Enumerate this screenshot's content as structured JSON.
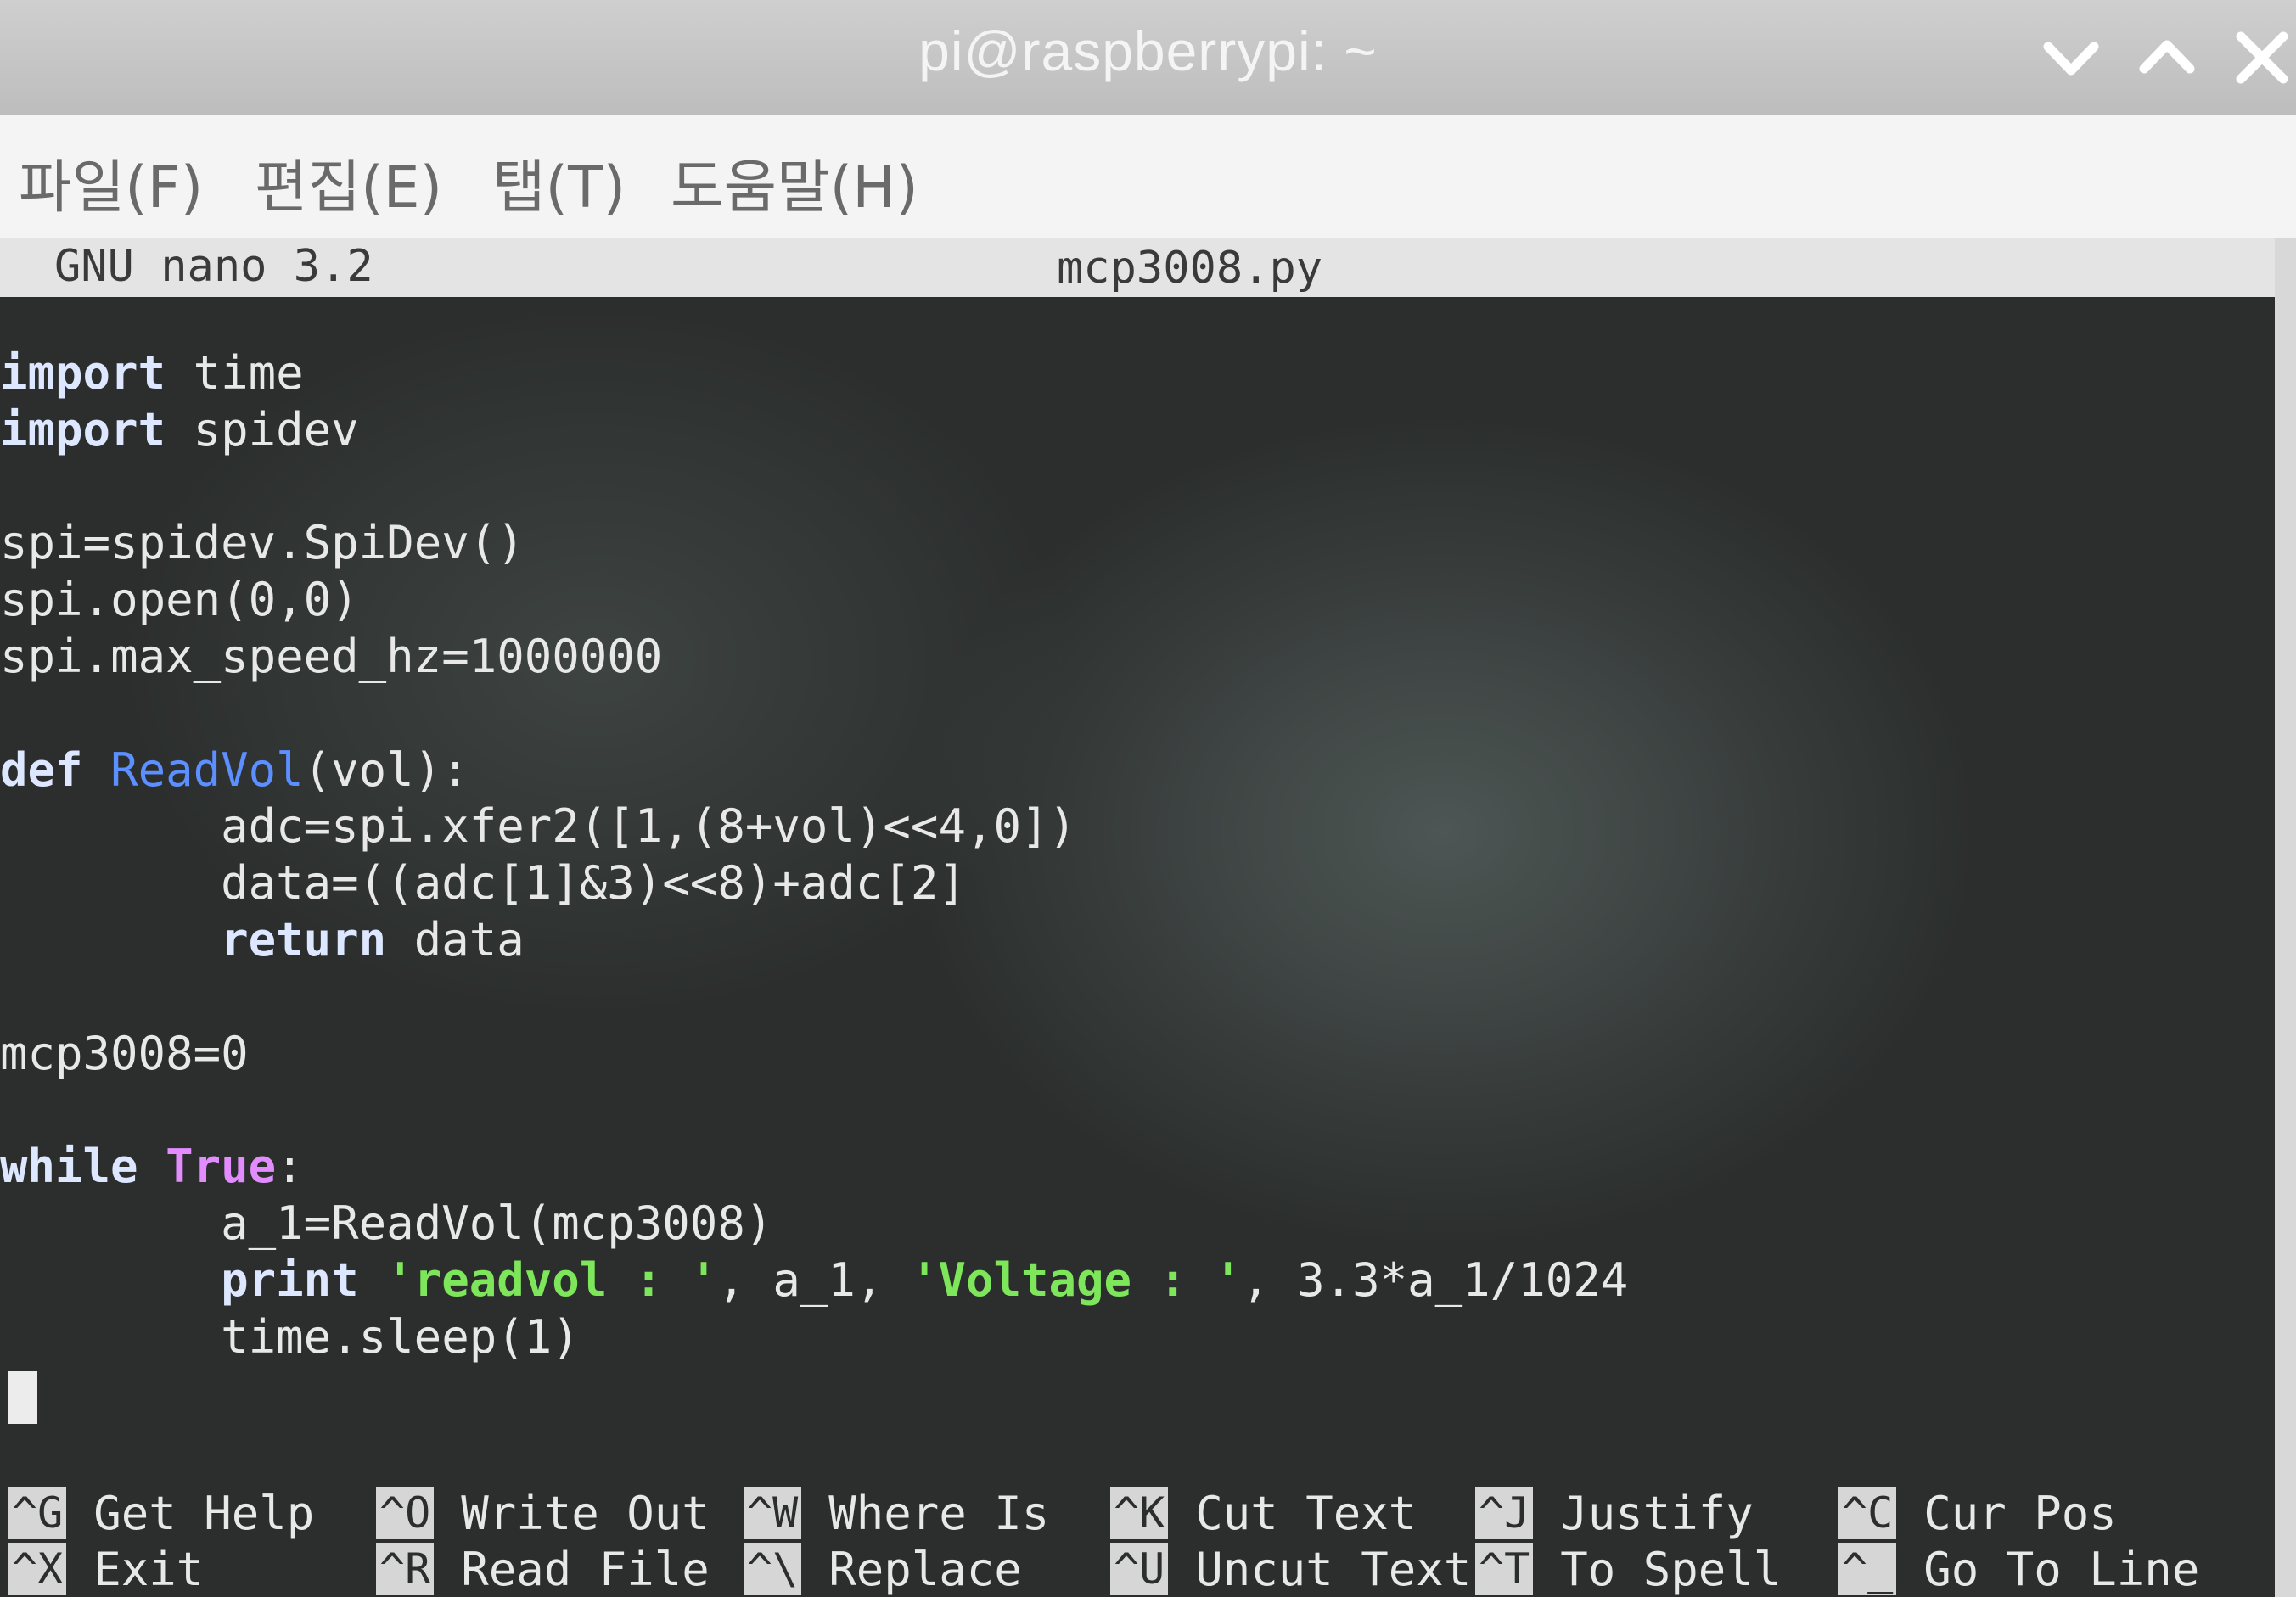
{
  "window": {
    "title": "pi@raspberrypi: ~"
  },
  "menu": {
    "items": [
      "파일(F)",
      "편집(E)",
      "탭(T)",
      "도움말(H)"
    ]
  },
  "nano": {
    "version": "GNU nano 3.2",
    "filename": "mcp3008.py"
  },
  "code_lines": [
    "import time",
    "import spidev",
    "",
    "spi=spidev.SpiDev()",
    "spi.open(0,0)",
    "spi.max_speed_hz=1000000",
    "",
    "def ReadVol(vol):",
    "        adc=spi.xfer2([1,(8+vol)<<4,0])",
    "        data=((adc[1]&3)<<8)+adc[2]",
    "        return data",
    "",
    "mcp3008=0",
    "",
    "while True:",
    "        a_1=ReadVol(mcp3008)",
    "        print 'readvol : ', a_1, 'Voltage : ', 3.3*a_1/1024",
    "        time.sleep(1)"
  ],
  "shortcuts": [
    {
      "key": "^G",
      "label": "Get Help"
    },
    {
      "key": "^O",
      "label": "Write Out"
    },
    {
      "key": "^W",
      "label": "Where Is"
    },
    {
      "key": "^K",
      "label": "Cut Text"
    },
    {
      "key": "^J",
      "label": "Justify"
    },
    {
      "key": "^C",
      "label": "Cur Pos"
    },
    {
      "key": "^X",
      "label": "Exit"
    },
    {
      "key": "^R",
      "label": "Read File"
    },
    {
      "key": "^\\",
      "label": "Replace"
    },
    {
      "key": "^U",
      "label": "Uncut Text"
    },
    {
      "key": "^T",
      "label": "To Spell"
    },
    {
      "key": "^_",
      "label": "Go To Line"
    }
  ],
  "icons": {
    "minimize": "chevron-down-icon",
    "maximize": "chevron-up-icon",
    "close": "close-icon"
  },
  "colors": {
    "keyword": "#dde7ff",
    "function": "#5c8fff",
    "boolean": "#e38cff",
    "string": "#7ee65a",
    "terminal_bg": "#2b2e2d"
  }
}
